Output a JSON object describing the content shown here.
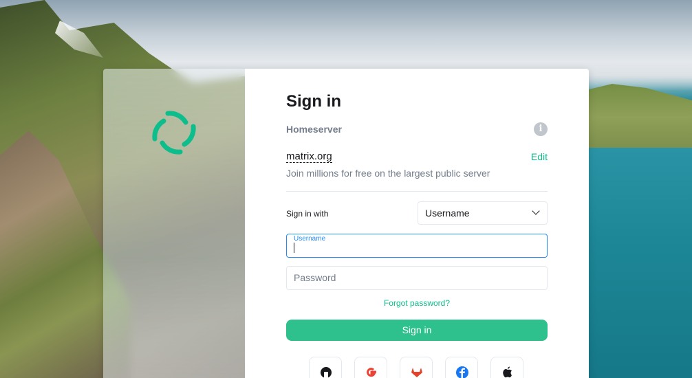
{
  "login": {
    "title": "Sign in",
    "homeserver_label": "Homeserver",
    "server_name": "matrix.org",
    "edit_label": "Edit",
    "server_description": "Join millions for free on the largest public server",
    "signin_with_label": "Sign in with",
    "signin_with_value": "Username",
    "username_label": "Username",
    "password_placeholder": "Password",
    "forgot_label": "Forgot password?",
    "signin_button": "Sign in"
  },
  "sso_providers": [
    "github-icon",
    "google-icon",
    "gitlab-icon",
    "facebook-icon",
    "apple-icon"
  ],
  "colors": {
    "accent": "#0dbd8b",
    "button": "#2fc18d",
    "focus": "#238cf5",
    "muted_text": "#737d8c"
  }
}
